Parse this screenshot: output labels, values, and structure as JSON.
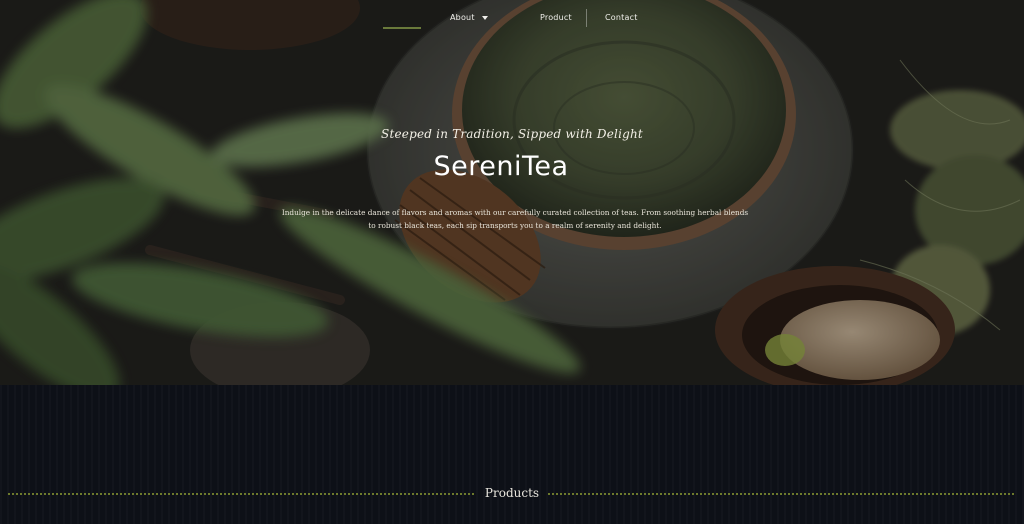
{
  "nav": {
    "items": [
      {
        "label": "About"
      },
      {
        "label": "Product"
      },
      {
        "label": "Contact"
      }
    ]
  },
  "hero": {
    "tagline": "Steeped in Tradition, Sipped with Delight",
    "brand": "SereniTea",
    "intro": "Indulge in the delicate dance of flavors and aromas with our carefully curated collection of teas. From soothing herbal blends to robust black teas, each sip transports you to a realm of serenity and delight."
  },
  "sections": {
    "products_title": "Products"
  },
  "colors": {
    "accent": "#6a7a3b",
    "background": "#0d1017"
  }
}
